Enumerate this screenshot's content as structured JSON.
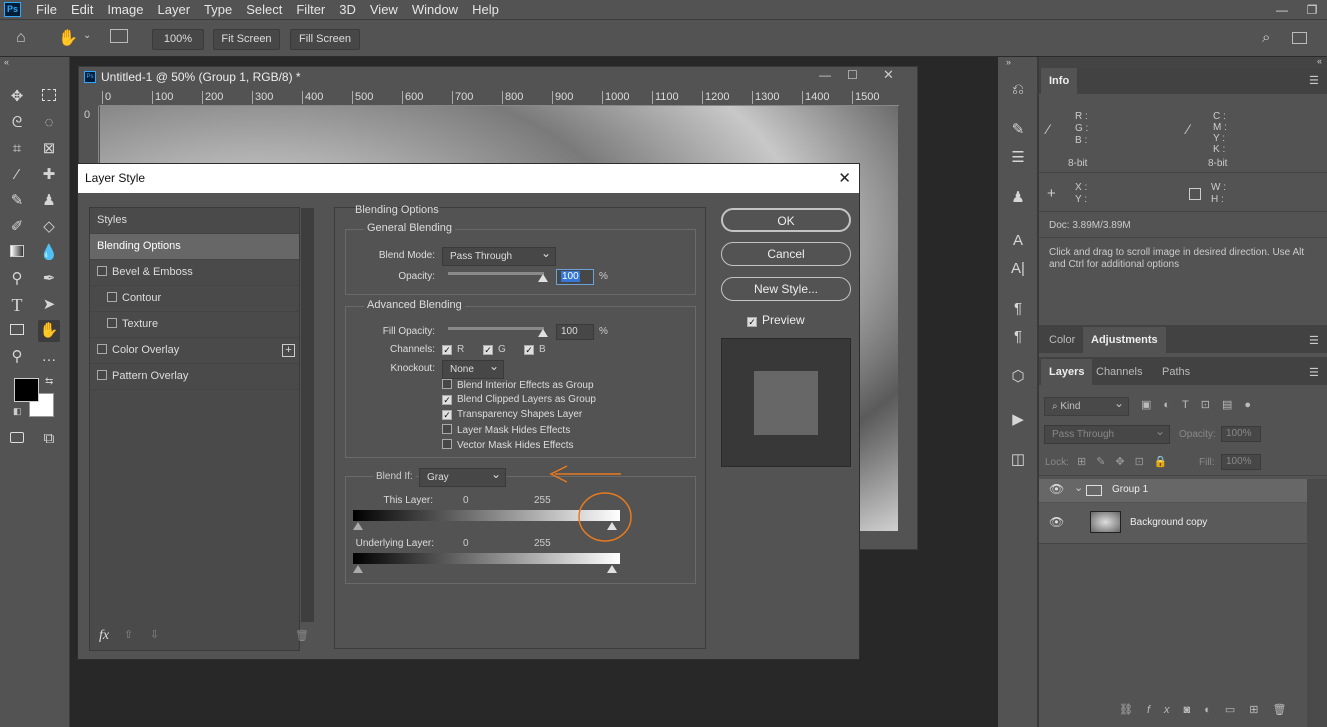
{
  "menubar": {
    "logo": "Ps",
    "items": [
      "File",
      "Edit",
      "Image",
      "Layer",
      "Type",
      "Select",
      "Filter",
      "3D",
      "View",
      "Window",
      "Help"
    ],
    "win_min": "—",
    "win_max": "❐",
    "win_close": "✕"
  },
  "options": {
    "zoom_btn": "100%",
    "fit_btn": "Fit Screen",
    "fill_btn": "Fill Screen"
  },
  "document": {
    "title": "Untitled-1 @ 50% (Group 1, RGB/8) *",
    "ruler_ticks": [
      "0",
      "100",
      "200",
      "300",
      "400",
      "500",
      "600",
      "700",
      "800",
      "900",
      "1000",
      "1100",
      "1200",
      "1300",
      "1400",
      "1500"
    ],
    "ruler_v": "0"
  },
  "dialog": {
    "title": "Layer Style",
    "styles_header": "Styles",
    "style_items": [
      {
        "label": "Blending Options",
        "checkbox": false,
        "selected": true
      },
      {
        "label": "Bevel & Emboss",
        "checkbox": true
      },
      {
        "label": "Contour",
        "checkbox": true,
        "indent": true
      },
      {
        "label": "Texture",
        "checkbox": true,
        "indent": true
      },
      {
        "label": "Color Overlay",
        "checkbox": true,
        "plus": true
      },
      {
        "label": "Pattern Overlay",
        "checkbox": true
      }
    ],
    "blending_title": "Blending Options",
    "general_title": "General Blending",
    "blend_mode_label": "Blend Mode:",
    "blend_mode": "Pass Through",
    "opacity_label": "Opacity:",
    "opacity": "100",
    "opacity_level": 1.0,
    "pct": "%",
    "advanced_title": "Advanced Blending",
    "fill_opacity_label": "Fill Opacity:",
    "fill_opacity": "100",
    "fill_level": 1.0,
    "channels_label": "Channels:",
    "channels": [
      "R",
      "G",
      "B"
    ],
    "knockout_label": "Knockout:",
    "knockout": "None",
    "adv_options": [
      {
        "label": "Blend Interior Effects as Group",
        "checked": false
      },
      {
        "label": "Blend Clipped Layers as Group",
        "checked": true
      },
      {
        "label": "Transparency Shapes Layer",
        "checked": true
      },
      {
        "label": "Layer Mask Hides Effects",
        "checked": false
      },
      {
        "label": "Vector Mask Hides Effects",
        "checked": false
      }
    ],
    "blendif_label": "Blend If:",
    "blendif": "Gray",
    "this_layer_label": "This Layer:",
    "underlying_label": "Underlying Layer:",
    "min": "0",
    "max": "255",
    "buttons": {
      "ok": "OK",
      "cancel": "Cancel",
      "new_style": "New Style...",
      "preview": "Preview"
    },
    "fx": "fx"
  },
  "info": {
    "tab": "Info",
    "rgb": [
      "R :",
      "G :",
      "B :"
    ],
    "cmyk": [
      "C :",
      "M :",
      "Y :",
      "K :"
    ],
    "bit1": "8-bit",
    "bit2": "8-bit",
    "xy": [
      "X :",
      "Y :"
    ],
    "wh": [
      "W :",
      "H :"
    ],
    "doc": "Doc: 3.89M/3.89M",
    "hint": "Click and drag to scroll image in desired direction.  Use Alt and Ctrl for additional options"
  },
  "color_tabs": [
    "Color",
    "Adjustments"
  ],
  "layer_tabs": [
    "Layers",
    "Channels",
    "Paths"
  ],
  "layers": {
    "kind": "Kind",
    "blend": "Pass Through",
    "opacity_label": "Opacity:",
    "opacity": "100%",
    "lock_label": "Lock:",
    "fill_label": "Fill:",
    "fill": "100%",
    "items": [
      {
        "name": "Group 1",
        "type": "group"
      },
      {
        "name": "Background copy",
        "type": "layer"
      }
    ]
  },
  "colors": {
    "accent": "#e87a1e",
    "ps_blue": "#31a8ff"
  }
}
